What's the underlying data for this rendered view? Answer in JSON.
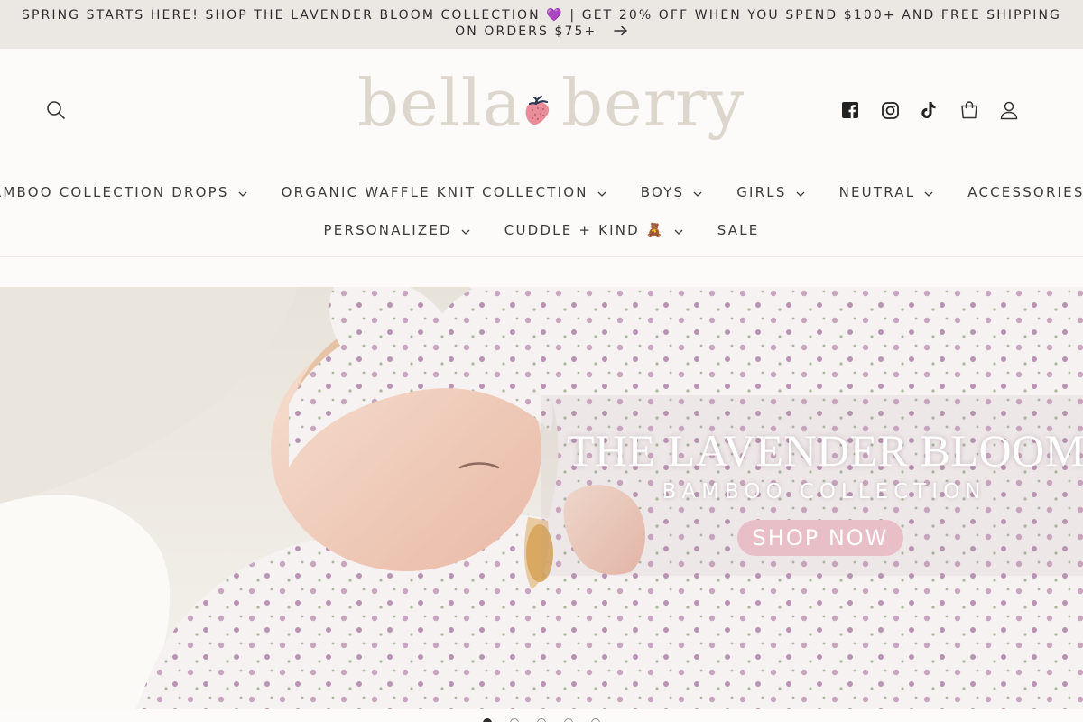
{
  "announcement": {
    "text": "SPRING STARTS HERE! SHOP THE LAVENDER BLOOM COLLECTION 💜 | GET 20% OFF WHEN YOU SPEND $100+ AND FREE SHIPPING ON ORDERS $75+",
    "arrow_icon": "arrow-right-icon"
  },
  "header": {
    "logo_word_1": "bella",
    "logo_word_2": "berry",
    "logo_icon": "strawberry-icon",
    "left_icons": [
      "search-icon"
    ],
    "right_icons": [
      "facebook-icon",
      "instagram-icon",
      "tiktok-icon",
      "cart-icon",
      "account-icon"
    ]
  },
  "nav": {
    "row1": [
      {
        "label": "BAMBOO COLLECTION DROPS",
        "has_dropdown": true
      },
      {
        "label": "ORGANIC WAFFLE KNIT COLLECTION",
        "has_dropdown": true
      },
      {
        "label": "BOYS",
        "has_dropdown": true
      },
      {
        "label": "GIRLS",
        "has_dropdown": true
      },
      {
        "label": "NEUTRAL",
        "has_dropdown": true
      },
      {
        "label": "ACCESSORIES",
        "has_dropdown": true
      }
    ],
    "row2": [
      {
        "label": "PERSONALIZED",
        "has_dropdown": true
      },
      {
        "label": "CUDDLE + KIND 🧸",
        "has_dropdown": true
      },
      {
        "label": "SALE",
        "has_dropdown": false
      }
    ]
  },
  "hero": {
    "title": "THE LAVENDER BLOOM",
    "subtitle": "BAMBOO COLLECTION",
    "cta_label": "SHOP NOW",
    "cta_color": "#e8bec7",
    "slide_count": 5,
    "active_slide": 1
  },
  "colors": {
    "announcement_bg": "#ebe7e3",
    "page_bg": "#fcfbf9",
    "logo_text": "#ddd6cd",
    "strawberry": "#e98e99"
  }
}
